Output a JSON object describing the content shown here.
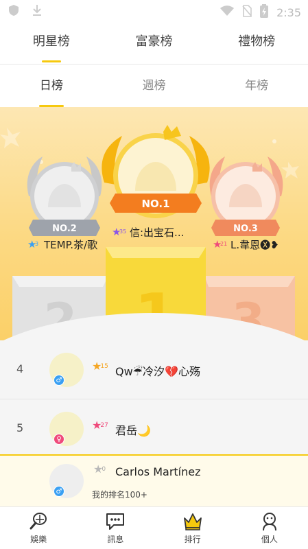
{
  "status_bar": {
    "time": "2:35"
  },
  "top_tabs": [
    {
      "label": "明星榜",
      "active": true
    },
    {
      "label": "富豪榜",
      "active": false
    },
    {
      "label": "禮物榜",
      "active": false
    }
  ],
  "period_tabs": [
    {
      "label": "日榜",
      "active": true
    },
    {
      "label": "週榜",
      "active": false
    },
    {
      "label": "年榜",
      "active": false
    }
  ],
  "podium": {
    "first": {
      "badge": "NO.1",
      "level": "35",
      "name": "信:出宝石...",
      "block": "1"
    },
    "second": {
      "badge": "NO.2",
      "level": "3",
      "name": "TEMP.茶/歌",
      "block": "2"
    },
    "third": {
      "badge": "NO.3",
      "level": "21",
      "name": "L.韋恩🅧❥",
      "block": "3"
    }
  },
  "ranking_list": [
    {
      "rank": "4",
      "level": "15",
      "name": "Qw☔冷汐💔心殇",
      "gender": "male",
      "star_color": "#f5a623"
    },
    {
      "rank": "5",
      "level": "27",
      "name": "君岳🌙",
      "gender": "female",
      "star_color": "#ef4a7b"
    }
  ],
  "my_rank": {
    "name": "Carlos Martínez",
    "level": "0",
    "text": "我的排名100+",
    "gender": "male"
  },
  "bottom_nav": [
    {
      "label": "娛樂",
      "icon": "racket-icon"
    },
    {
      "label": "訊息",
      "icon": "chat-icon"
    },
    {
      "label": "排行",
      "icon": "crown-icon"
    },
    {
      "label": "個人",
      "icon": "person-icon"
    }
  ],
  "colors": {
    "accent": "#f6c90e",
    "male": "#3aa0f3",
    "female": "#ef4a7b"
  }
}
